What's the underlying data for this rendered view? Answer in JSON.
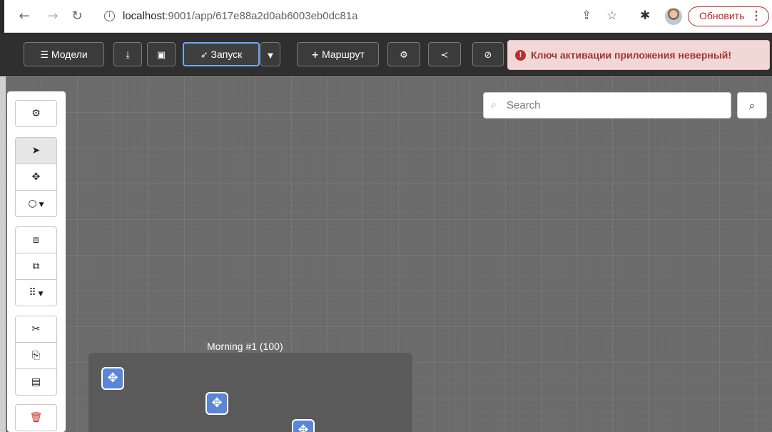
{
  "browser": {
    "back_icon": "arrow-left-icon",
    "forward_icon": "arrow-right-icon",
    "reload_icon": "reload-icon",
    "url_host": "localhost",
    "url_path": ":9001/app/617e88a2d0ab6003eb0dc81a",
    "share_icon": "share-icon",
    "bookmark_icon": "star-icon",
    "extensions_icon": "puzzle-icon",
    "update_label": "Обновить"
  },
  "toolbar": {
    "models_label": "Модели",
    "launch_label": "Запуск",
    "route_label": "Маршрут",
    "alert_text": "Ключ активации приложения неверный!"
  },
  "search": {
    "placeholder": "Search"
  },
  "canvas": {
    "group_label": "Morning #1 (100)"
  },
  "colors": {
    "alert_text": "#a33533",
    "alert_bg": "#f2d7d7",
    "launch_border": "#6ea8ff",
    "node_fill": "#5b86d6",
    "toolbar_bg": "#2f2f2f",
    "canvas_bg": "#6b6b6b"
  }
}
